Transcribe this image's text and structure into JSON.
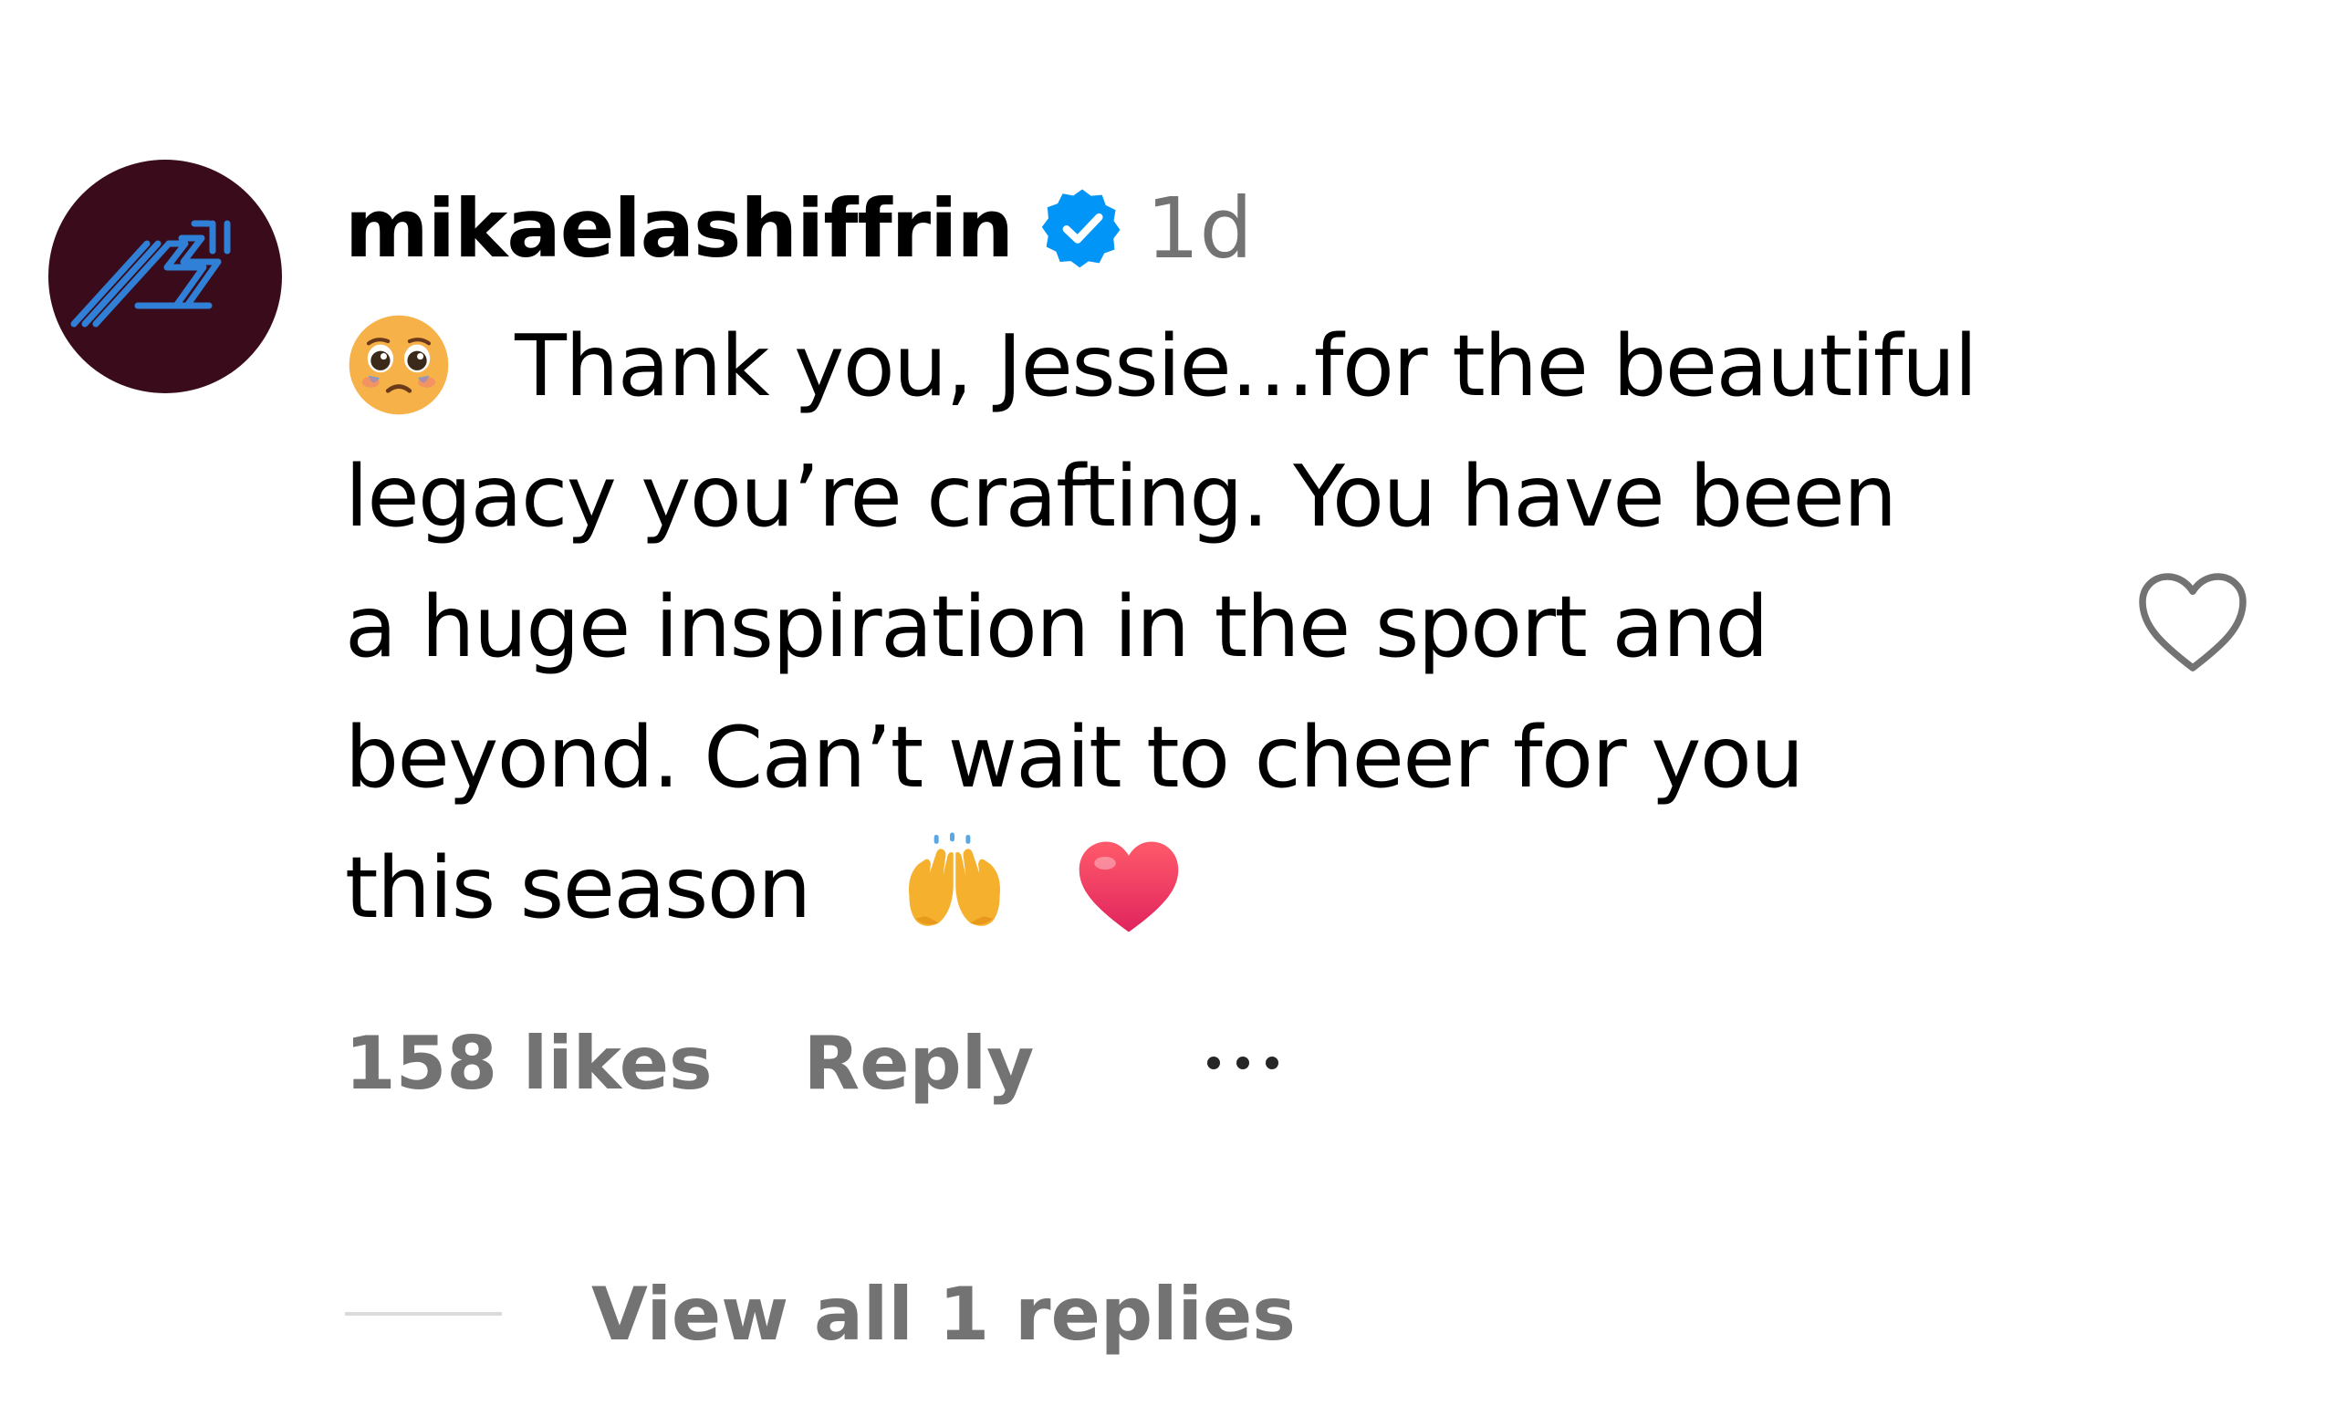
{
  "comment": {
    "username": "mikaelashiffrin",
    "verified": true,
    "time": "1d",
    "lines": [
      "Thank you, Jessie…for the beautiful",
      "legacy you’re crafting. You have been",
      "a huge inspiration in the sport and",
      "beyond. Can’t wait to cheer for you",
      "this season"
    ],
    "emojis": {
      "leading": "pleading-face",
      "trailing": [
        "raising-hands",
        "red-heart"
      ]
    },
    "likes_label": "158 likes",
    "reply_label": "Reply",
    "view_replies_label": "View all 1 replies"
  },
  "colors": {
    "avatar_bg": "#3a0b1b",
    "avatar_logo": "#2f80d6",
    "verified_badge": "#0095f6",
    "muted_text": "#737373",
    "divider": "#dbdbdb"
  },
  "icons": {
    "verified": "verified-badge-icon",
    "like": "heart-outline-icon",
    "more": "more-options-icon"
  }
}
